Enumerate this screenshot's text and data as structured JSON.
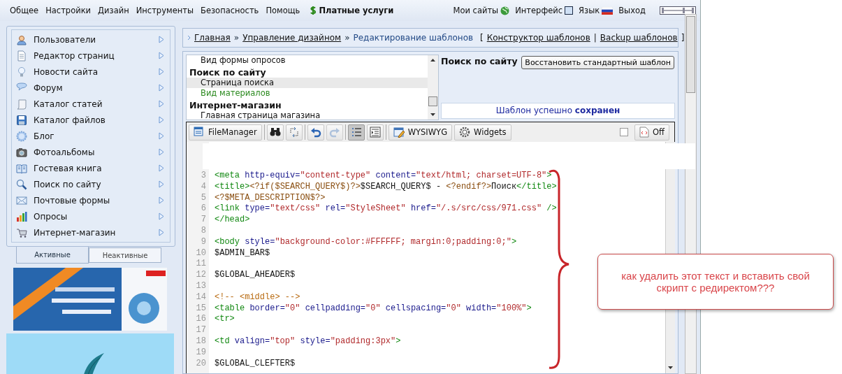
{
  "top_menu": {
    "items": [
      "Общее",
      "Настройки",
      "Дизайн",
      "Инструменты",
      "Безопасность",
      "Помощь"
    ],
    "paid": "Платные услуги",
    "right": [
      "Мои сайты",
      "Интерфейс",
      "Язык",
      "Выход"
    ]
  },
  "sidebar": {
    "items": [
      "Пользователи",
      "Редактор страниц",
      "Новости сайта",
      "Форум",
      "Каталог статей",
      "Каталог файлов",
      "Блог",
      "Фотоальбомы",
      "Гостевая книга",
      "Поиск по сайту",
      "Почтовые формы",
      "Опросы",
      "Интернет-магазин"
    ],
    "tabs": [
      {
        "label": "Активные",
        "selected": true
      },
      {
        "label": "Неактивные",
        "selected": false
      }
    ]
  },
  "breadcrumb": {
    "items": [
      {
        "label": "Главная",
        "link": true
      },
      {
        "label": "Управление дизайном",
        "link": true
      },
      {
        "label": "Редактирование шаблонов",
        "link": false
      }
    ],
    "separator": "»",
    "open_bracket": "[",
    "divider": "|",
    "close_bracket": "]",
    "links": [
      "Конструктор шаблонов",
      "Backup шаблонов"
    ]
  },
  "templates": {
    "list": [
      {
        "kind": "item",
        "label": "Вид формы опросов",
        "selected": false,
        "modified": false
      },
      {
        "kind": "group",
        "label": "Поиск по сайту"
      },
      {
        "kind": "item",
        "label": "Страница поиска",
        "selected": true,
        "modified": false
      },
      {
        "kind": "item",
        "label": "Вид материалов",
        "selected": false,
        "modified": true
      },
      {
        "kind": "group",
        "label": "Интернет-магазин"
      },
      {
        "kind": "item",
        "label": "Главная страница магазина",
        "selected": false,
        "modified": false
      }
    ],
    "title": "Поиск по сайту",
    "restore_button": "Восстановить стандартный шаблон",
    "status": "Шаблон успешно **сохранен**"
  },
  "toolbar": {
    "items": [
      {
        "kind": "button",
        "label": "FileManager",
        "pressed": false,
        "disabled": false
      },
      {
        "kind": "separator"
      },
      {
        "kind": "icon",
        "pressed": false,
        "disabled": false
      },
      {
        "kind": "icon",
        "pressed": false,
        "disabled": false
      },
      {
        "kind": "separator"
      },
      {
        "kind": "icon",
        "pressed": false,
        "disabled": false
      },
      {
        "kind": "icon",
        "pressed": false,
        "disabled": true
      },
      {
        "kind": "separator"
      },
      {
        "kind": "icon",
        "pressed": true,
        "disabled": false
      },
      {
        "kind": "icon",
        "pressed": false,
        "disabled": false
      },
      {
        "kind": "separator"
      },
      {
        "kind": "button",
        "label": "WYSIWYG",
        "pressed": false,
        "disabled": false
      },
      {
        "kind": "button",
        "label": "Widgets",
        "pressed": false,
        "disabled": false
      }
    ],
    "checkbox": {
      "checked": false
    },
    "off_button": "Off"
  },
  "code": {
    "lines": [
      {
        "number": "3",
        "tokens": [
          {
            "kind": "tag",
            "text": "<meta"
          },
          {
            "kind": "attr",
            "text": " http-equiv="
          },
          {
            "kind": "value",
            "text": "\"content-type\""
          },
          {
            "kind": "attr",
            "text": " content="
          },
          {
            "kind": "value",
            "text": "\"text/html; charset=UTF-8\""
          },
          {
            "kind": "tag",
            "text": ">"
          }
        ]
      },
      {
        "number": "4",
        "tokens": [
          {
            "kind": "tag",
            "text": "<title>"
          },
          {
            "kind": "php",
            "text": "<?if($SEARCH_QUERY$)?>"
          },
          {
            "kind": "text",
            "text": "$SEARCH_QUERY$ - "
          },
          {
            "kind": "php",
            "text": "<?endif?>"
          },
          {
            "kind": "text",
            "text": "Поиск"
          },
          {
            "kind": "tag",
            "text": "</title>"
          }
        ]
      },
      {
        "number": "5",
        "tokens": [
          {
            "kind": "php",
            "text": "<?$META_DESCRIPTION$?>"
          }
        ]
      },
      {
        "number": "6",
        "tokens": [
          {
            "kind": "tag",
            "text": "<link"
          },
          {
            "kind": "attr",
            "text": " type="
          },
          {
            "kind": "value",
            "text": "\"text/css\""
          },
          {
            "kind": "attr",
            "text": " rel="
          },
          {
            "kind": "value",
            "text": "\"StyleSheet\""
          },
          {
            "kind": "attr",
            "text": " href="
          },
          {
            "kind": "value",
            "text": "\"/.s/src/css/971.css\""
          },
          {
            "kind": "tag",
            "text": " />"
          }
        ]
      },
      {
        "number": "7",
        "tokens": [
          {
            "kind": "tag",
            "text": "</head>"
          }
        ]
      },
      {
        "number": "8"
      },
      {
        "number": "9",
        "tokens": [
          {
            "kind": "tag",
            "text": "<body"
          },
          {
            "kind": "attr",
            "text": " style="
          },
          {
            "kind": "value",
            "text": "\"background-color:#FFFFFF; margin:0;padding:0;\""
          },
          {
            "kind": "tag",
            "text": ">"
          }
        ]
      },
      {
        "number": "10",
        "tokens": [
          {
            "kind": "text",
            "text": "$ADMIN_BAR$"
          }
        ]
      },
      {
        "number": "11"
      },
      {
        "number": "12",
        "tokens": [
          {
            "kind": "text",
            "text": "$GLOBAL_AHEADER$"
          }
        ]
      },
      {
        "number": "13"
      },
      {
        "number": "14",
        "tokens": [
          {
            "kind": "comment",
            "text": "<!-- <middle> -->"
          }
        ]
      },
      {
        "number": "15",
        "tokens": [
          {
            "kind": "tag",
            "text": "<table"
          },
          {
            "kind": "attr",
            "text": " border="
          },
          {
            "kind": "value",
            "text": "\"0\""
          },
          {
            "kind": "attr",
            "text": " cellpadding="
          },
          {
            "kind": "value",
            "text": "\"0\""
          },
          {
            "kind": "attr",
            "text": " cellspacing="
          },
          {
            "kind": "value",
            "text": "\"0\""
          },
          {
            "kind": "attr",
            "text": " width="
          },
          {
            "kind": "value",
            "text": "\"100%\""
          },
          {
            "kind": "tag",
            "text": ">"
          }
        ]
      },
      {
        "number": "16",
        "tokens": [
          {
            "kind": "tag",
            "text": "<tr>"
          }
        ]
      },
      {
        "number": "17"
      },
      {
        "number": "18",
        "tokens": [
          {
            "kind": "tag",
            "text": "<td"
          },
          {
            "kind": "attr",
            "text": " valign="
          },
          {
            "kind": "value",
            "text": "\"top\""
          },
          {
            "kind": "attr",
            "text": " style="
          },
          {
            "kind": "value",
            "text": "\"padding:3px\""
          },
          {
            "kind": "tag",
            "text": ">"
          }
        ]
      },
      {
        "number": "19"
      },
      {
        "number": "20",
        "tokens": [
          {
            "kind": "text",
            "text": "$GLOBAL_CLEFTER$"
          }
        ]
      }
    ]
  },
  "annotation": {
    "text": "как удалить этот текст и вставить свой скрипт с редиректом???"
  }
}
